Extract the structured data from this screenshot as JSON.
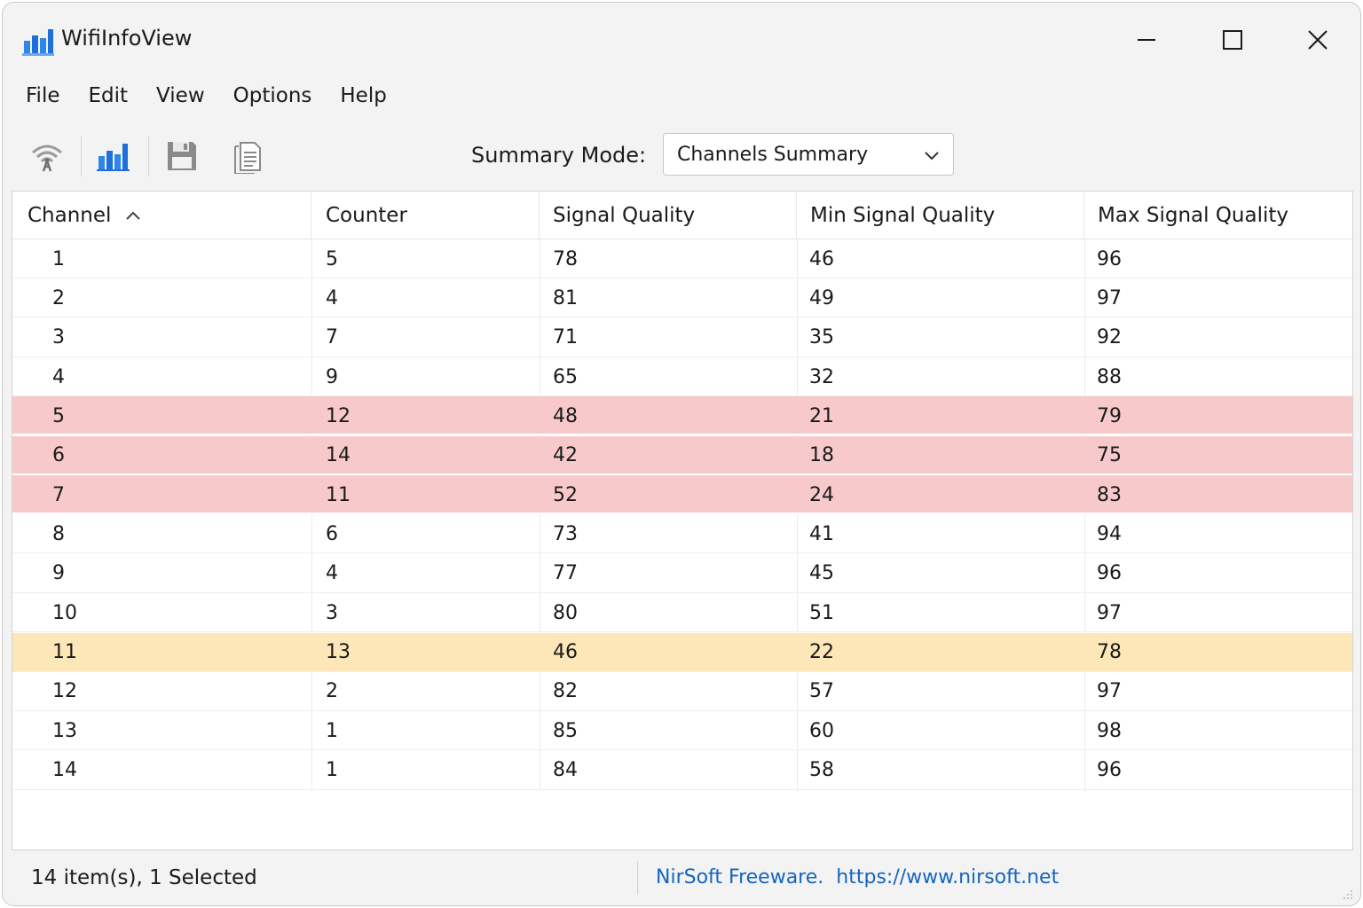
{
  "window": {
    "title": "WifiInfoView"
  },
  "menu": [
    "File",
    "Edit",
    "View",
    "Options",
    "Help"
  ],
  "toolbar": {
    "summary_label": "Summary Mode:",
    "summary_value": "Channels Summary",
    "icons": [
      "wifi-antenna-icon",
      "bar-chart-icon",
      "save-icon",
      "document-icon"
    ]
  },
  "colors": {
    "accent": "#1e6fd9",
    "highlight_row": "#f8c9cb",
    "selected_row": "#fde7b8",
    "link": "#1565c0"
  },
  "table": {
    "columns": [
      "Channel",
      "Counter",
      "Signal Quality",
      "Min Signal Quality",
      "Max Signal Quality"
    ],
    "sort_column": "Channel",
    "sort_direction": "ascending",
    "rows": [
      {
        "cells": [
          "1",
          "5",
          "78",
          "46",
          "96"
        ],
        "style": ""
      },
      {
        "cells": [
          "2",
          "4",
          "81",
          "49",
          "97"
        ],
        "style": ""
      },
      {
        "cells": [
          "3",
          "7",
          "71",
          "35",
          "92"
        ],
        "style": ""
      },
      {
        "cells": [
          "4",
          "9",
          "65",
          "32",
          "88"
        ],
        "style": ""
      },
      {
        "cells": [
          "5",
          "12",
          "48",
          "21",
          "79"
        ],
        "style": "red"
      },
      {
        "cells": [
          "6",
          "14",
          "42",
          "18",
          "75"
        ],
        "style": "red"
      },
      {
        "cells": [
          "7",
          "11",
          "52",
          "24",
          "83"
        ],
        "style": "red"
      },
      {
        "cells": [
          "8",
          "6",
          "73",
          "41",
          "94"
        ],
        "style": ""
      },
      {
        "cells": [
          "9",
          "4",
          "77",
          "45",
          "96"
        ],
        "style": ""
      },
      {
        "cells": [
          "10",
          "3",
          "80",
          "51",
          "97"
        ],
        "style": ""
      },
      {
        "cells": [
          "11",
          "13",
          "46",
          "22",
          "78"
        ],
        "style": "selected"
      },
      {
        "cells": [
          "12",
          "2",
          "82",
          "57",
          "97"
        ],
        "style": ""
      },
      {
        "cells": [
          "13",
          "1",
          "85",
          "60",
          "98"
        ],
        "style": ""
      },
      {
        "cells": [
          "14",
          "1",
          "84",
          "58",
          "96"
        ],
        "style": ""
      }
    ]
  },
  "status": {
    "items": "14 item(s), 1 Selected",
    "freeware": "NirSoft Freeware.",
    "url": "https://www.nirsoft.net"
  }
}
